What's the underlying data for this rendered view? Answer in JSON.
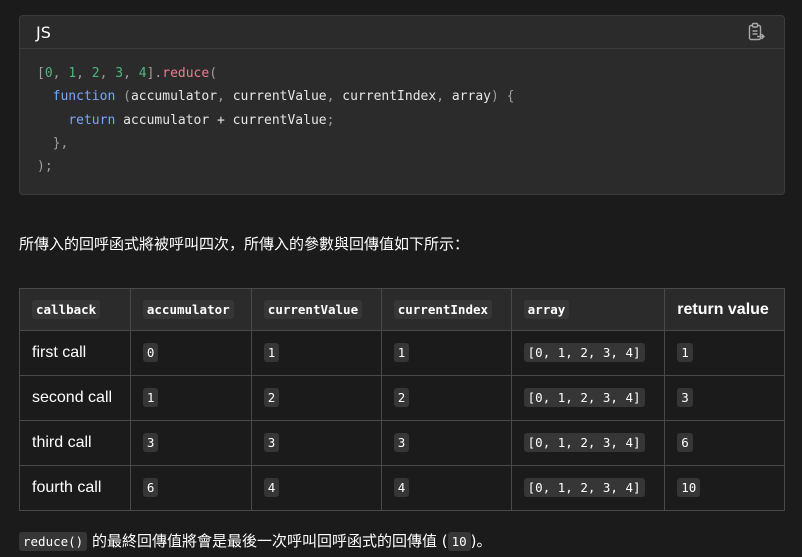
{
  "code_block": {
    "language": "JS",
    "copy_icon": "copy-clipboard-icon",
    "lines": [
      [
        {
          "t": "[",
          "c": "punc"
        },
        {
          "t": "0",
          "c": "num"
        },
        {
          "t": ", ",
          "c": "punc"
        },
        {
          "t": "1",
          "c": "num"
        },
        {
          "t": ", ",
          "c": "punc"
        },
        {
          "t": "2",
          "c": "num"
        },
        {
          "t": ", ",
          "c": "punc"
        },
        {
          "t": "3",
          "c": "num"
        },
        {
          "t": ", ",
          "c": "punc"
        },
        {
          "t": "4",
          "c": "num"
        },
        {
          "t": "].",
          "c": "punc"
        },
        {
          "t": "reduce",
          "c": "fn"
        },
        {
          "t": "(",
          "c": "punc"
        }
      ],
      [
        {
          "t": "  ",
          "c": "txt"
        },
        {
          "t": "function",
          "c": "kw"
        },
        {
          "t": " ",
          "c": "txt"
        },
        {
          "t": "(",
          "c": "punc"
        },
        {
          "t": "accumulator",
          "c": "txt"
        },
        {
          "t": ", ",
          "c": "punc"
        },
        {
          "t": "currentValue",
          "c": "txt"
        },
        {
          "t": ", ",
          "c": "punc"
        },
        {
          "t": "currentIndex",
          "c": "txt"
        },
        {
          "t": ", ",
          "c": "punc"
        },
        {
          "t": "array",
          "c": "txt"
        },
        {
          "t": ") {",
          "c": "punc"
        }
      ],
      [
        {
          "t": "    ",
          "c": "txt"
        },
        {
          "t": "return",
          "c": "kw"
        },
        {
          "t": " accumulator + currentValue",
          "c": "txt"
        },
        {
          "t": ";",
          "c": "punc"
        }
      ],
      [
        {
          "t": "  },",
          "c": "punc"
        }
      ],
      [
        {
          "t": ");",
          "c": "punc"
        }
      ]
    ]
  },
  "intro_text": "所傳入的回呼函式將被呼叫四次，所傳入的參數與回傳值如下所示：",
  "table": {
    "headers": [
      {
        "text": "callback",
        "code": true
      },
      {
        "text": "accumulator",
        "code": true
      },
      {
        "text": "currentValue",
        "code": true
      },
      {
        "text": "currentIndex",
        "code": true
      },
      {
        "text": "array",
        "code": true
      },
      {
        "text": "return value",
        "code": false
      }
    ],
    "rows": [
      {
        "call": "first call",
        "accumulator": "0",
        "currentValue": "1",
        "currentIndex": "1",
        "array": "[0, 1, 2, 3, 4]",
        "return_value": "1"
      },
      {
        "call": "second call",
        "accumulator": "1",
        "currentValue": "2",
        "currentIndex": "2",
        "array": "[0, 1, 2, 3, 4]",
        "return_value": "3"
      },
      {
        "call": "third call",
        "accumulator": "3",
        "currentValue": "3",
        "currentIndex": "3",
        "array": "[0, 1, 2, 3, 4]",
        "return_value": "6"
      },
      {
        "call": "fourth call",
        "accumulator": "6",
        "currentValue": "4",
        "currentIndex": "4",
        "array": "[0, 1, 2, 3, 4]",
        "return_value": "10"
      }
    ]
  },
  "summary": {
    "code_reduce": "reduce()",
    "text_middle": " 的最終回傳值將會是最後一次呼叫回呼函式的回傳值 (",
    "code_value": "10",
    "text_end": ")。"
  },
  "colors": {
    "background": "#1b1b1b",
    "code_background": "#2b2b2b",
    "number_token": "#4eb77f",
    "function_token": "#f27a8f",
    "keyword_token": "#79a6ff"
  }
}
